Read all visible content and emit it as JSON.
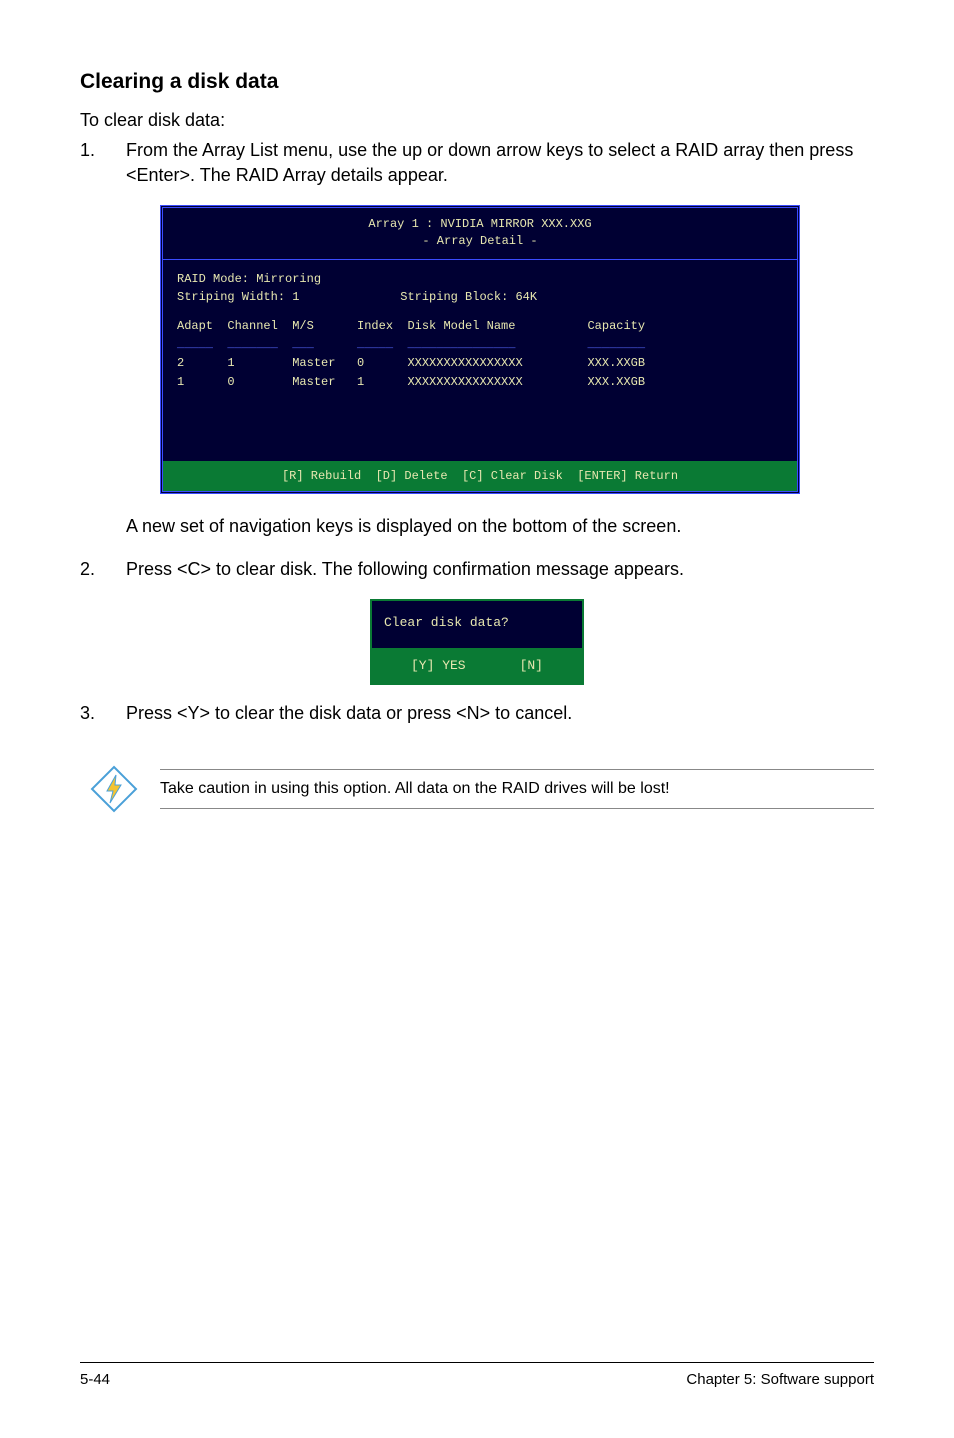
{
  "section_title": "Clearing a disk data",
  "intro": "To clear disk data:",
  "steps": {
    "s1_num": "1.",
    "s1_text": "From the Array List menu, use the up or down arrow keys to select a RAID array then press <Enter>. The RAID Array details appear.",
    "s1_after": "A new set of  navigation keys is displayed on the bottom of the screen.",
    "s2_num": "2.",
    "s2_text": "Press <C> to clear disk. The following confirmation message appears.",
    "s3_num": "3.",
    "s3_text": "Press <Y> to clear the disk data or press <N> to cancel."
  },
  "bios": {
    "title_line1": "Array 1 : NVIDIA MIRROR  XXX.XXG",
    "title_line2": "- Array Detail -",
    "raid_mode": "RAID Mode: Mirroring",
    "strip_width": "Striping Width: 1",
    "strip_block": "Striping Block: 64K",
    "hdr_row": "Adapt  Channel  M/S      Index  Disk Model Name          Capacity",
    "hdr_und": "_____  _______  ___      _____  _______________          ________",
    "rows": [
      "2      1        Master   0      XXXXXXXXXXXXXXXX         XXX.XXGB",
      "1      0        Master   1      XXXXXXXXXXXXXXXX         XXX.XXGB"
    ],
    "footer": "[R] Rebuild  [D] Delete  [C] Clear Disk  [ENTER] Return"
  },
  "dialog": {
    "question": "Clear disk data?",
    "yes": "[Y] YES",
    "no": "[N]"
  },
  "note_text": "Take caution in using this option. All data on the RAID drives will be lost!",
  "footer": {
    "left": "5-44",
    "right": "Chapter 5: Software support"
  }
}
